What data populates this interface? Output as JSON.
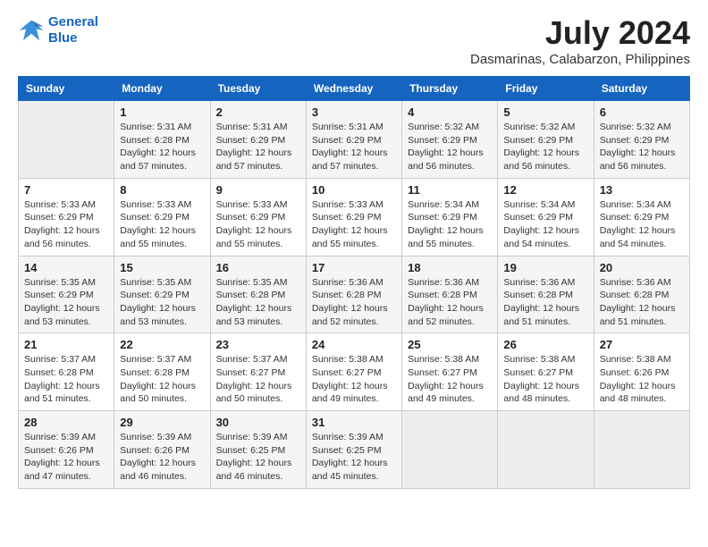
{
  "logo": {
    "line1": "General",
    "line2": "Blue"
  },
  "title": "July 2024",
  "subtitle": "Dasmarinas, Calabarzon, Philippines",
  "days_header": [
    "Sunday",
    "Monday",
    "Tuesday",
    "Wednesday",
    "Thursday",
    "Friday",
    "Saturday"
  ],
  "weeks": [
    [
      {
        "num": "",
        "detail": ""
      },
      {
        "num": "1",
        "detail": "Sunrise: 5:31 AM\nSunset: 6:28 PM\nDaylight: 12 hours\nand 57 minutes."
      },
      {
        "num": "2",
        "detail": "Sunrise: 5:31 AM\nSunset: 6:29 PM\nDaylight: 12 hours\nand 57 minutes."
      },
      {
        "num": "3",
        "detail": "Sunrise: 5:31 AM\nSunset: 6:29 PM\nDaylight: 12 hours\nand 57 minutes."
      },
      {
        "num": "4",
        "detail": "Sunrise: 5:32 AM\nSunset: 6:29 PM\nDaylight: 12 hours\nand 56 minutes."
      },
      {
        "num": "5",
        "detail": "Sunrise: 5:32 AM\nSunset: 6:29 PM\nDaylight: 12 hours\nand 56 minutes."
      },
      {
        "num": "6",
        "detail": "Sunrise: 5:32 AM\nSunset: 6:29 PM\nDaylight: 12 hours\nand 56 minutes."
      }
    ],
    [
      {
        "num": "7",
        "detail": "Sunrise: 5:33 AM\nSunset: 6:29 PM\nDaylight: 12 hours\nand 56 minutes."
      },
      {
        "num": "8",
        "detail": "Sunrise: 5:33 AM\nSunset: 6:29 PM\nDaylight: 12 hours\nand 55 minutes."
      },
      {
        "num": "9",
        "detail": "Sunrise: 5:33 AM\nSunset: 6:29 PM\nDaylight: 12 hours\nand 55 minutes."
      },
      {
        "num": "10",
        "detail": "Sunrise: 5:33 AM\nSunset: 6:29 PM\nDaylight: 12 hours\nand 55 minutes."
      },
      {
        "num": "11",
        "detail": "Sunrise: 5:34 AM\nSunset: 6:29 PM\nDaylight: 12 hours\nand 55 minutes."
      },
      {
        "num": "12",
        "detail": "Sunrise: 5:34 AM\nSunset: 6:29 PM\nDaylight: 12 hours\nand 54 minutes."
      },
      {
        "num": "13",
        "detail": "Sunrise: 5:34 AM\nSunset: 6:29 PM\nDaylight: 12 hours\nand 54 minutes."
      }
    ],
    [
      {
        "num": "14",
        "detail": "Sunrise: 5:35 AM\nSunset: 6:29 PM\nDaylight: 12 hours\nand 53 minutes."
      },
      {
        "num": "15",
        "detail": "Sunrise: 5:35 AM\nSunset: 6:29 PM\nDaylight: 12 hours\nand 53 minutes."
      },
      {
        "num": "16",
        "detail": "Sunrise: 5:35 AM\nSunset: 6:28 PM\nDaylight: 12 hours\nand 53 minutes."
      },
      {
        "num": "17",
        "detail": "Sunrise: 5:36 AM\nSunset: 6:28 PM\nDaylight: 12 hours\nand 52 minutes."
      },
      {
        "num": "18",
        "detail": "Sunrise: 5:36 AM\nSunset: 6:28 PM\nDaylight: 12 hours\nand 52 minutes."
      },
      {
        "num": "19",
        "detail": "Sunrise: 5:36 AM\nSunset: 6:28 PM\nDaylight: 12 hours\nand 51 minutes."
      },
      {
        "num": "20",
        "detail": "Sunrise: 5:36 AM\nSunset: 6:28 PM\nDaylight: 12 hours\nand 51 minutes."
      }
    ],
    [
      {
        "num": "21",
        "detail": "Sunrise: 5:37 AM\nSunset: 6:28 PM\nDaylight: 12 hours\nand 51 minutes."
      },
      {
        "num": "22",
        "detail": "Sunrise: 5:37 AM\nSunset: 6:28 PM\nDaylight: 12 hours\nand 50 minutes."
      },
      {
        "num": "23",
        "detail": "Sunrise: 5:37 AM\nSunset: 6:27 PM\nDaylight: 12 hours\nand 50 minutes."
      },
      {
        "num": "24",
        "detail": "Sunrise: 5:38 AM\nSunset: 6:27 PM\nDaylight: 12 hours\nand 49 minutes."
      },
      {
        "num": "25",
        "detail": "Sunrise: 5:38 AM\nSunset: 6:27 PM\nDaylight: 12 hours\nand 49 minutes."
      },
      {
        "num": "26",
        "detail": "Sunrise: 5:38 AM\nSunset: 6:27 PM\nDaylight: 12 hours\nand 48 minutes."
      },
      {
        "num": "27",
        "detail": "Sunrise: 5:38 AM\nSunset: 6:26 PM\nDaylight: 12 hours\nand 48 minutes."
      }
    ],
    [
      {
        "num": "28",
        "detail": "Sunrise: 5:39 AM\nSunset: 6:26 PM\nDaylight: 12 hours\nand 47 minutes."
      },
      {
        "num": "29",
        "detail": "Sunrise: 5:39 AM\nSunset: 6:26 PM\nDaylight: 12 hours\nand 46 minutes."
      },
      {
        "num": "30",
        "detail": "Sunrise: 5:39 AM\nSunset: 6:25 PM\nDaylight: 12 hours\nand 46 minutes."
      },
      {
        "num": "31",
        "detail": "Sunrise: 5:39 AM\nSunset: 6:25 PM\nDaylight: 12 hours\nand 45 minutes."
      },
      {
        "num": "",
        "detail": ""
      },
      {
        "num": "",
        "detail": ""
      },
      {
        "num": "",
        "detail": ""
      }
    ]
  ]
}
